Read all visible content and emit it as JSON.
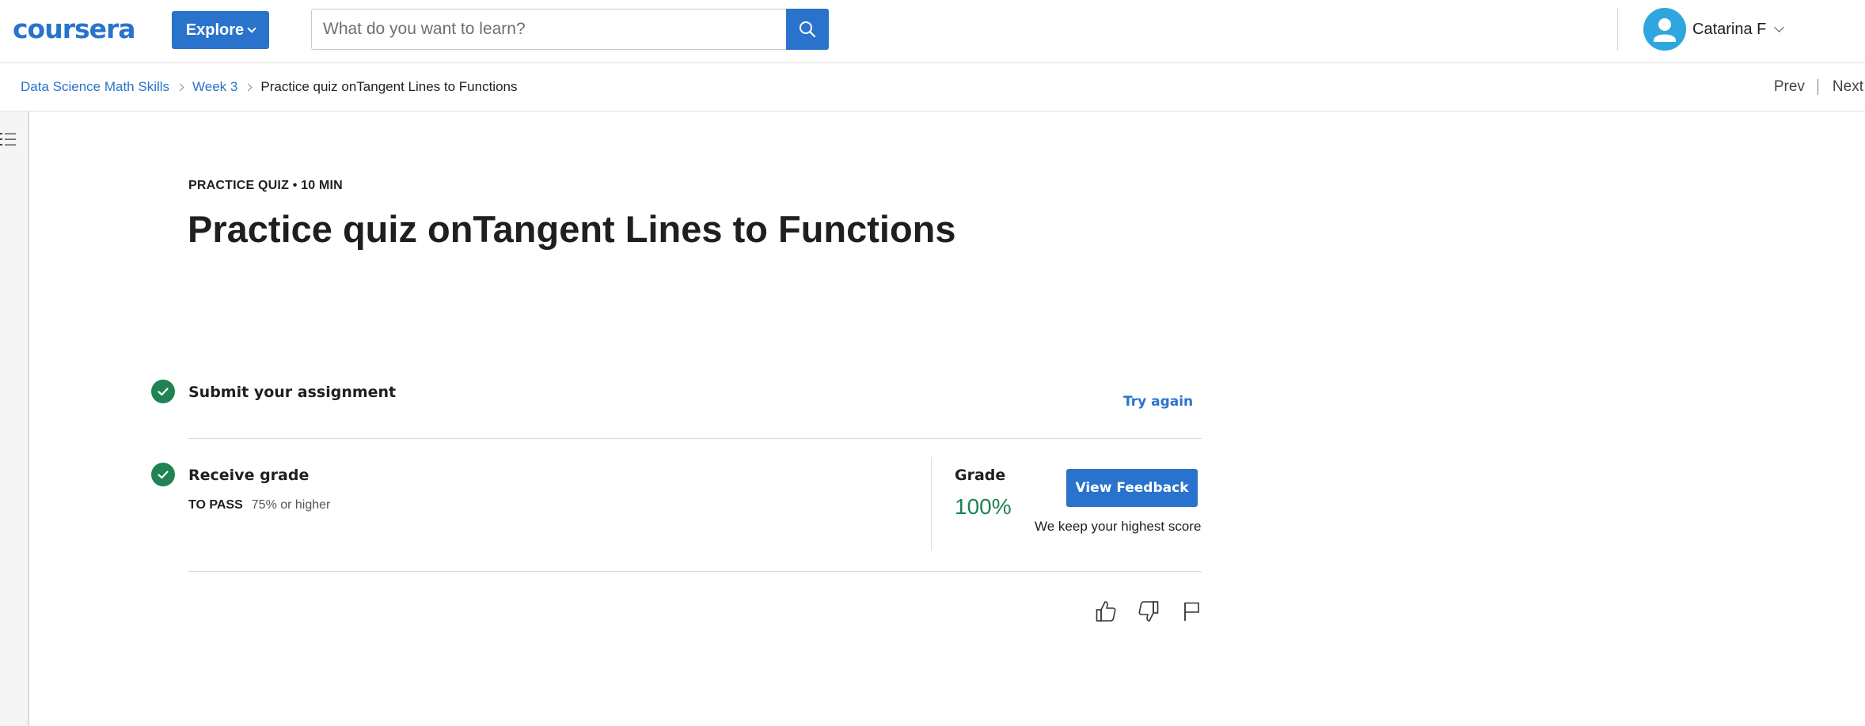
{
  "header": {
    "logo_text": "coursera",
    "explore_label": "Explore",
    "search_placeholder": "What do you want to learn?",
    "user_name": "Catarina F"
  },
  "breadcrumb": {
    "items": [
      "Data Science Math Skills",
      "Week 3"
    ],
    "current": "Practice quiz onTangent Lines to Functions"
  },
  "nav": {
    "prev_label": "Prev",
    "next_label": "Next"
  },
  "quiz": {
    "eyebrow": "PRACTICE QUIZ • 10 MIN",
    "title": "Practice quiz onTangent Lines to Functions"
  },
  "steps": {
    "submit": {
      "title": "Submit your assignment",
      "action_label": "Try again"
    },
    "receive": {
      "title": "Receive grade",
      "pass_label": "TO PASS",
      "pass_value": "75% or higher"
    }
  },
  "grade": {
    "label": "Grade",
    "value": "100%",
    "button_label": "View Feedback",
    "note": "We keep your highest score"
  },
  "colors": {
    "brand_blue": "#2a73cc",
    "success_green": "#1f8354",
    "avatar_blue": "#2fa6df"
  },
  "icons": [
    "search-icon",
    "chevron-down-icon",
    "user-icon",
    "list-icon",
    "check-icon",
    "thumbs-up-icon",
    "thumbs-down-icon",
    "flag-icon"
  ]
}
